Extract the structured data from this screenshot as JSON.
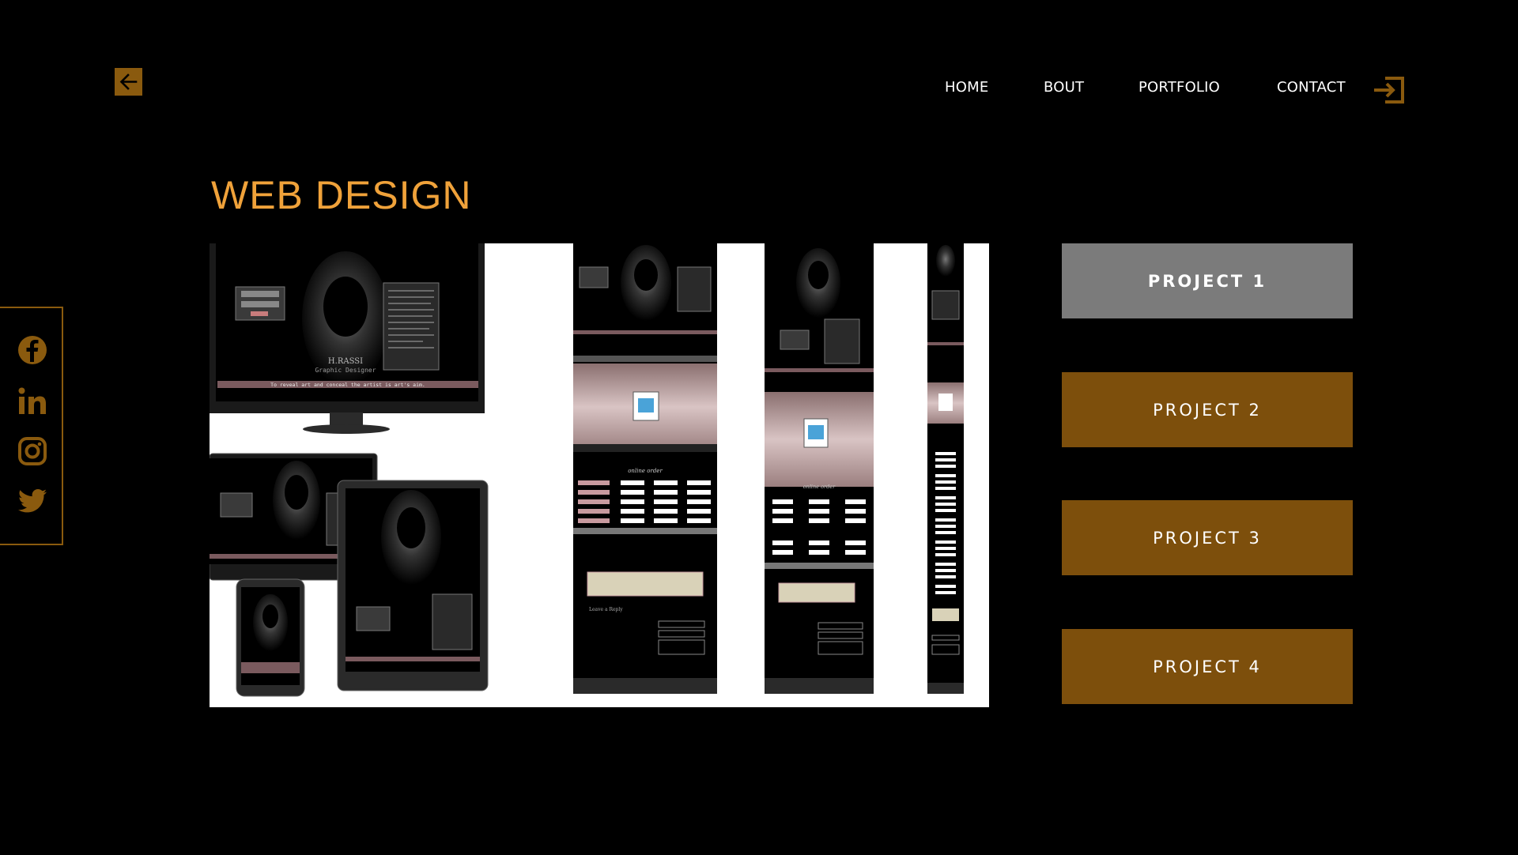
{
  "header": {
    "back_icon": "arrow-left-icon",
    "nav": [
      "HOME",
      "BOUT",
      "PORTFOLIO",
      "CONTACT"
    ],
    "login_icon": "sign-in-icon"
  },
  "page": {
    "title": "WEB DESIGN"
  },
  "social": {
    "icons": [
      "facebook-icon",
      "linkedin-icon",
      "instagram-icon",
      "twitter-icon"
    ]
  },
  "mockup": {
    "brand_name": "H.RASSI",
    "brand_role": "Graphic Designer",
    "tagline": "To reveal art and conceal the artist is art's aim.",
    "section_heading": "online order",
    "contact_heading": "Leave a Reply"
  },
  "projects": [
    {
      "label": "PROJECT 1",
      "active": true
    },
    {
      "label": "PROJECT 2",
      "active": false
    },
    {
      "label": "PROJECT 3",
      "active": false
    },
    {
      "label": "PROJECT 4",
      "active": false
    }
  ],
  "colors": {
    "background": "#000000",
    "accent": "#f0a23a",
    "button_brown": "#7d4f0c",
    "button_active": "#7b7b7b",
    "icon_gold": "#8a5a0e"
  }
}
